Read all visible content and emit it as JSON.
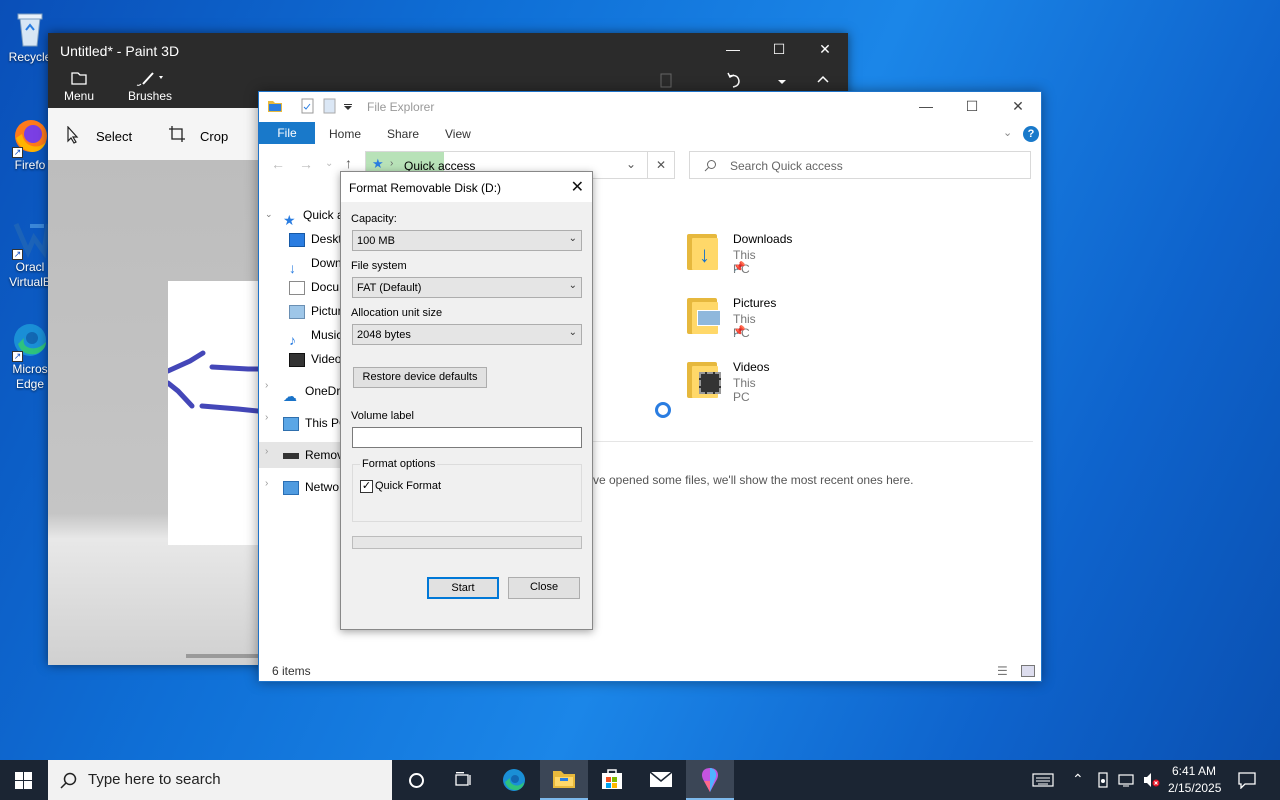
{
  "desktop": {
    "icons": [
      {
        "label": "Recycle",
        "icon": "recycle-bin-icon"
      },
      {
        "label": "Firefo",
        "icon": "firefox-icon"
      },
      {
        "label": "Oracl",
        "label2": "VirtualB",
        "icon": "virtualbox-icon"
      },
      {
        "label": "Micros",
        "label2": "Edge",
        "icon": "edge-icon"
      }
    ]
  },
  "paint": {
    "title": "Untitled* - Paint 3D",
    "menu_label": "Menu",
    "brushes_label": "Brushes",
    "select_label": "Select",
    "crop_label": "Crop"
  },
  "explorer": {
    "title": "File Explorer",
    "tabs": {
      "file": "File",
      "home": "Home",
      "share": "Share",
      "view": "View"
    },
    "address": "Quick access",
    "search_placeholder": "Search Quick access",
    "nav": [
      {
        "label": "Quick a",
        "icon": "star-icon"
      },
      {
        "label": "Deskt",
        "icon": "desktop-icon"
      },
      {
        "label": "Down",
        "icon": "download-icon"
      },
      {
        "label": "Docu",
        "icon": "documents-icon"
      },
      {
        "label": "Pictur",
        "icon": "pictures-icon"
      },
      {
        "label": "Music",
        "icon": "music-icon"
      },
      {
        "label": "Video",
        "icon": "videos-icon"
      },
      {
        "label": "OneDri",
        "icon": "onedrive-icon"
      },
      {
        "label": "This PC",
        "icon": "computer-icon"
      },
      {
        "label": "Remov",
        "icon": "drive-icon"
      },
      {
        "label": "Netwo",
        "icon": "network-icon"
      }
    ],
    "folders": [
      {
        "name": "Downloads",
        "location": "This PC"
      },
      {
        "name": "Pictures",
        "location": "This PC"
      },
      {
        "name": "Videos",
        "location": "This PC"
      }
    ],
    "recent_message": "ve opened some files, we'll show the most recent ones here.",
    "status": "6 items"
  },
  "dialog": {
    "title": "Format Removable Disk (D:)",
    "capacity_label": "Capacity:",
    "capacity_value": "100 MB",
    "fs_label": "File system",
    "fs_value": "FAT (Default)",
    "alloc_label": "Allocation unit size",
    "alloc_value": "2048 bytes",
    "restore_label": "Restore device defaults",
    "volume_label": "Volume label",
    "volume_value": "",
    "format_options_label": "Format options",
    "quick_format_label": "Quick Format",
    "quick_format_checked": true,
    "start_label": "Start",
    "close_label": "Close"
  },
  "taskbar": {
    "search_placeholder": "Type here to search",
    "time": "6:41 AM",
    "date": "2/15/2025"
  }
}
